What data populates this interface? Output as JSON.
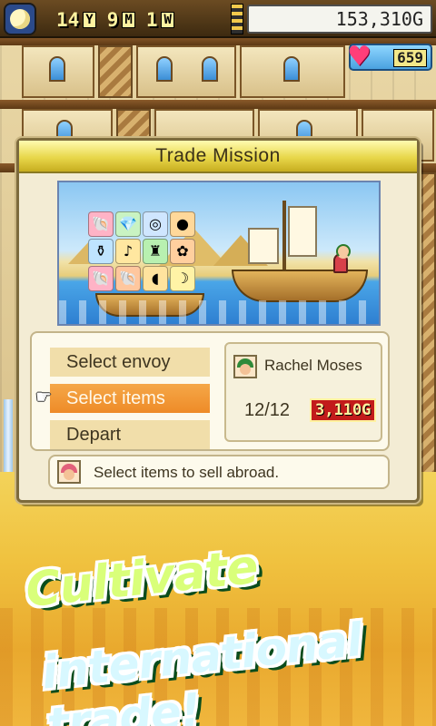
{
  "hud": {
    "year": "14",
    "year_unit": "Y",
    "month": "9",
    "month_unit": "M",
    "week": "1",
    "week_unit": "W",
    "money": "153,310G",
    "heart_points": "659"
  },
  "modal": {
    "title": "Trade Mission",
    "menu": [
      {
        "label": "Select envoy",
        "active": false
      },
      {
        "label": "Select items",
        "active": true
      },
      {
        "label": "Depart",
        "active": false
      }
    ],
    "envoy": {
      "name": "Rachel Moses",
      "count": "12/12",
      "cost": "3,110G"
    },
    "hint": "Select items to sell abroad."
  },
  "promo": {
    "line1": "Cultivate",
    "line2": "international trade!"
  },
  "colors": {
    "title_bar": "#e8d74a",
    "active_button": "#ee8b28",
    "idle_button": "#f1deaa",
    "promo_green": "#d9ff7a",
    "promo_blue": "#d8f8ff"
  }
}
